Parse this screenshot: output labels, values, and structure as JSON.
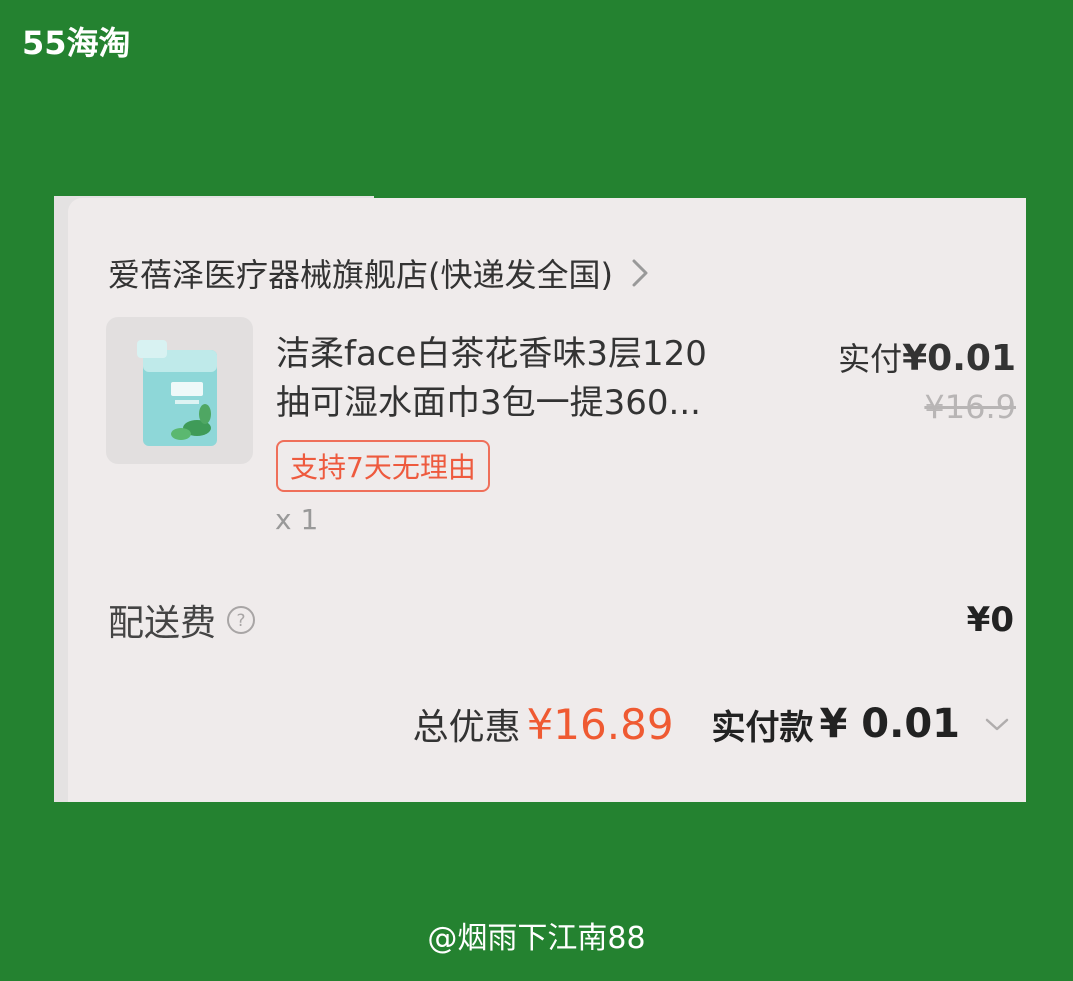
{
  "site_logo": "55海淘",
  "watermark": "@烟雨下江南88",
  "order": {
    "shop_name": "爱蓓泽医疗器械旗舰店(快递发全国)",
    "product": {
      "title_line1": "洁柔face白茶花香味3层120",
      "title_line2": "抽可湿水面巾3包一提360...",
      "badge": "支持7天无理由",
      "quantity": "x 1",
      "paid_label": "实付",
      "paid_amount": "¥0.01",
      "original_price": "¥16.9"
    },
    "shipping": {
      "label": "配送费",
      "value": "¥0",
      "help_icon": "question-circle-icon"
    },
    "summary": {
      "discount_label": "总优惠",
      "discount_value": "¥16.89",
      "total_label": "实付款",
      "total_value": "¥ 0.01"
    }
  },
  "colors": {
    "background": "#248230",
    "card": "#efebeb",
    "accent": "#ef5a32",
    "badge_border": "#ef6f5a"
  }
}
